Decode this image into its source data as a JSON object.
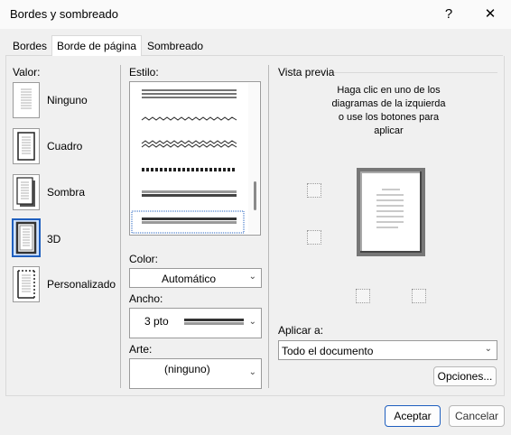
{
  "window": {
    "title": "Bordes y sombreado",
    "help": "?",
    "close": "✕"
  },
  "tabs": [
    {
      "label": "Bordes",
      "active": false
    },
    {
      "label": "Borde de página",
      "active": true
    },
    {
      "label": "Sombreado",
      "active": false
    }
  ],
  "setting": {
    "heading": "Valor:",
    "items": [
      {
        "label": "Ninguno",
        "icon": "setting-none-icon",
        "selected": false
      },
      {
        "label": "Cuadro",
        "icon": "setting-box-icon",
        "selected": false
      },
      {
        "label": "Sombra",
        "icon": "setting-shadow-icon",
        "selected": false
      },
      {
        "label": "3D",
        "icon": "setting-3d-icon",
        "selected": true
      },
      {
        "label": "Personalizado",
        "icon": "setting-custom-icon",
        "selected": false
      }
    ]
  },
  "style": {
    "heading": "Estilo:",
    "selected_index": 5
  },
  "color": {
    "label": "Color:",
    "value": "Automático"
  },
  "width": {
    "label": "Ancho:",
    "value": "3 pto"
  },
  "art": {
    "label": "Arte:",
    "value": "(ninguno)"
  },
  "preview": {
    "heading": "Vista previa",
    "instructions": "Haga clic en uno de los diagramas de la izquierda o use los botones para aplicar"
  },
  "apply": {
    "label": "Aplicar a:",
    "value": "Todo el documento"
  },
  "buttons": {
    "options": "Opciones...",
    "accept": "Aceptar",
    "cancel": "Cancelar"
  },
  "colors": {
    "accent": "#1f5fbf",
    "selected_bg": "#cfe3ff"
  }
}
